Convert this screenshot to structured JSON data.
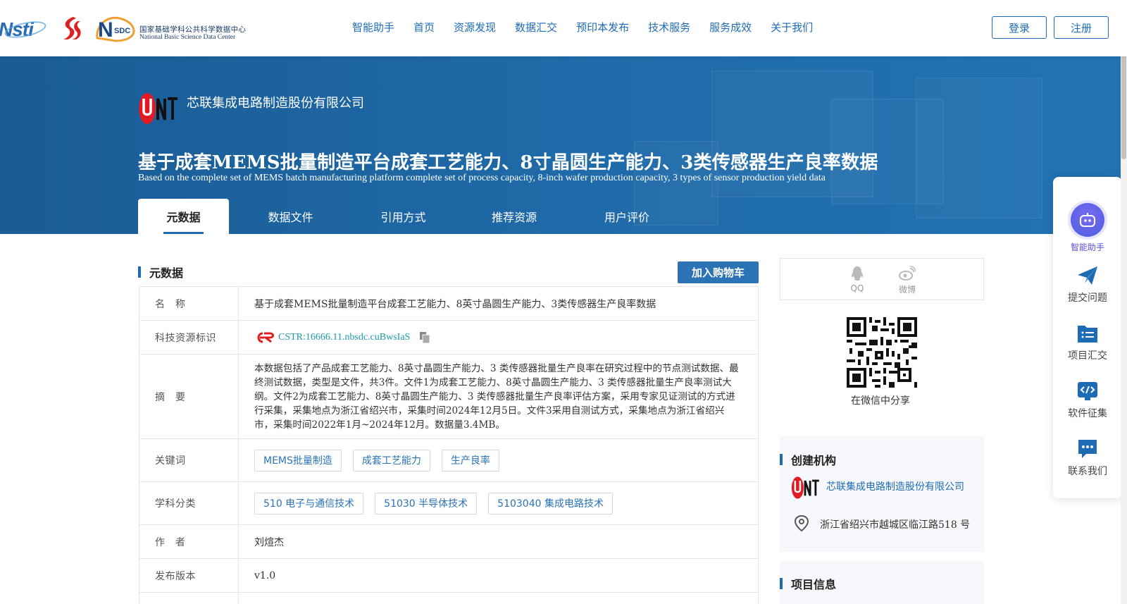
{
  "header": {
    "logos": {
      "nsti": "Nsti",
      "nsdc_cn": "国家基础学科公共科学数据中心",
      "nsdc_en": "National Basic Science Data Center",
      "nsdc_mark": "SDC"
    },
    "nav": [
      "智能助手",
      "首页",
      "资源发现",
      "数据汇交",
      "预印本发布",
      "技术服务",
      "服务成效",
      "关于我们"
    ],
    "login": "登录",
    "register": "注册"
  },
  "banner": {
    "org_name": "芯联集成电路制造股份有限公司",
    "title_cn": "基于成套MEMS批量制造平台成套工艺能力、8寸晶圆生产能力、3类传感器生产良率数据",
    "title_en": "Based on the complete set of MEMS batch manufacturing platform complete set of process capacity, 8-inch wafer production capacity, 3 types of sensor production yield data",
    "tabs": [
      "元数据",
      "数据文件",
      "引用方式",
      "推荐资源",
      "用户评价"
    ],
    "active_tab": 0
  },
  "metadata": {
    "section_title": "元数据",
    "cart_button": "加入购物车",
    "rows": {
      "name": {
        "label": "名　称",
        "value": "基于成套MEMS批量制造平台成套工艺能力、8英寸晶圆生产能力、3类传感器生产良率数据"
      },
      "cstr": {
        "label": "科技资源标识",
        "value": "CSTR:16666.11.nbsdc.cuBwsIaS"
      },
      "abstract": {
        "label": "摘　要",
        "value": "本数据包括了产品成套工艺能力、8英寸晶圆生产能力、3 类传感器批量生产良率在研究过程中的节点测试数据、最终测试数据，类型是文件，共3件。文件1为成套工艺能力、8英寸晶圆生产能力、3 类传感器批量生产良率测试大纲。文件2为成套工艺能力、8英寸晶圆生产能力、3 类传感器批量生产良率评估方案，采用专家见证测试的方式进行采集，采集地点为浙江省绍兴市，采集时间2024年12月5日。文件3采用自测试方式，采集地点为浙江省绍兴市，采集时间2022年1月~2024年12月。数据量3.4MB。"
      },
      "keywords": {
        "label": "关键词",
        "tags": [
          "MEMS批量制造",
          "成套工艺能力",
          "生产良率"
        ]
      },
      "subject": {
        "label": "学科分类",
        "tags": [
          "510 电子与通信技术",
          "51030 半导体技术",
          "5103040 集成电路技术"
        ]
      },
      "author": {
        "label": "作　者",
        "value": "刘煊杰"
      },
      "version": {
        "label": "发布版本",
        "value": "v1.0"
      }
    }
  },
  "sidebar": {
    "share": {
      "qq": "QQ",
      "weibo": "微博",
      "wechat_caption": "在微信中分享"
    },
    "institution": {
      "title": "创建机构",
      "name": "芯联集成电路制造股份有限公司",
      "address": "浙江省绍兴市越城区临江路518 号"
    },
    "project": {
      "title": "项目信息"
    }
  },
  "float_toolbar": [
    "智能助手",
    "提交问题",
    "项目汇交",
    "软件征集",
    "联系我们"
  ],
  "colors": {
    "primary": "#1f6bb3",
    "banner": "#1f6aa8",
    "cstr": "#1a9aa8",
    "ai": "#5a4fd8"
  }
}
